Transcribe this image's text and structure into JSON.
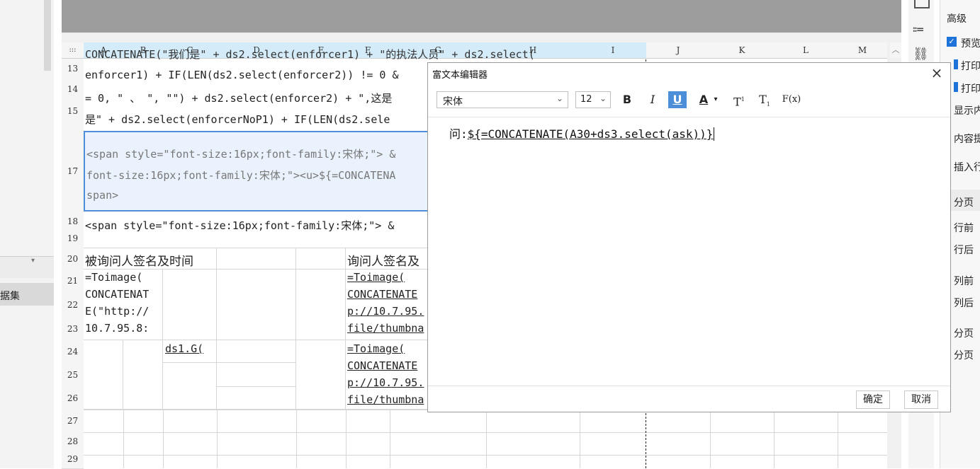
{
  "left_panel": {
    "dataset_label": "据集"
  },
  "columns": [
    "A",
    "B",
    "C",
    "D",
    "E",
    "F",
    "G",
    "H",
    "I",
    "J",
    "K",
    "L",
    "M"
  ],
  "rows": [
    "13",
    "14",
    "15",
    "17",
    "18",
    "19",
    "20",
    "21",
    "22",
    "23",
    "24",
    "25",
    "26",
    "27",
    "28",
    "29"
  ],
  "sheet": {
    "r13": "CONCATENATE(\"我们是\" + ds2.select(enforcer1) + \"的执法人员\" + ds2.select(",
    "r14": "enforcer1) + IF(LEN(ds2.select(enforcer2)) != 0 &",
    "r14b": "= 0, \" 、 \", \"\") + ds2.select(enforcer2) + \",这是",
    "r15": "是\" + ds2.select(enforcerNoP1) + IF(LEN(ds2.sele",
    "r17_1": "<span style=\"font-size:16px;font-family:宋体;\"> &",
    "r17_2": "font-size:16px;font-family:宋体;\"><u>${=CONCATENA",
    "r17_3": "span>",
    "r18": "<span style=\"font-size:16px;font-family:宋体;\"> &",
    "r20_a": "被询问人签名及时间",
    "r20_f": "询问人签名及",
    "r21_a": "=Toimage(",
    "r22_a": "CONCATENAT",
    "r22b_a": "E(\"http://",
    "r23_a": "10.7.95.8:",
    "r21_f": "=Toimage(",
    "r22_f": "CONCATENATE",
    "r22b_f": "p://10.7.95.",
    "r23_f": "file/thumbna",
    "r24_c": "ds1.G(",
    "r24_f": "=Toimage(",
    "r25_f": "CONCATENATE",
    "r25b_f": "p://10.7.95.",
    "r26_f": "file/thumbna"
  },
  "right_panel": {
    "header": "高级",
    "items": [
      "预览",
      "打印",
      "打印",
      "显示内容",
      "内容提示",
      "插入行策",
      "分页",
      "行前",
      "行后",
      "列前",
      "列后",
      "分页",
      "分页"
    ]
  },
  "dialog": {
    "title": "富文本编辑器",
    "close": "×",
    "font": "宋体",
    "size": "12",
    "tools": {
      "bold": "B",
      "italic": "I",
      "underline": "U",
      "color": "A",
      "sup": "T",
      "sub": "T",
      "fx": "F(x)"
    },
    "content_prefix": "问:",
    "content_formula": "${=CONCATENATE(A30+ds3.select(ask))}",
    "ok": "确定",
    "cancel": "取消"
  }
}
